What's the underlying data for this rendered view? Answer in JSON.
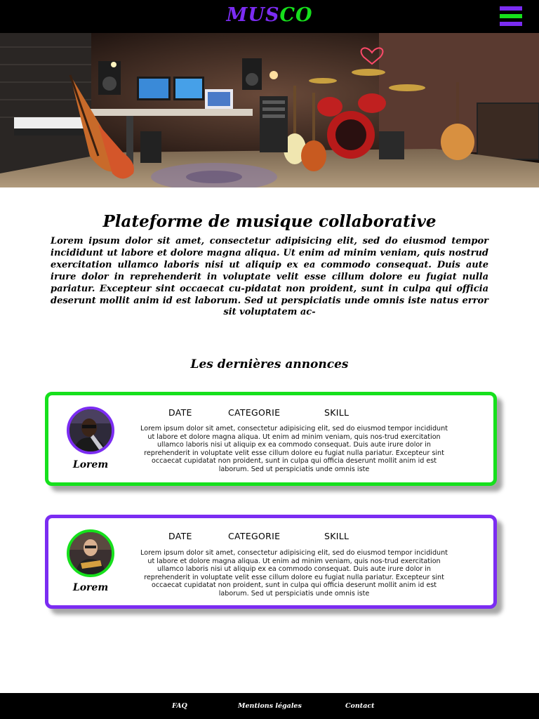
{
  "header": {
    "logo_part1": "MUS",
    "logo_part2": "CO",
    "menu_icon": "hamburger-menu-icon"
  },
  "colors": {
    "accent_purple": "#7b2cf2",
    "accent_green": "#16e01c",
    "header_bg": "#000000",
    "footer_bg": "#000000"
  },
  "hero": {
    "image": "music-studio-photo"
  },
  "intro": {
    "title": "Plateforme de musique collaborative",
    "text": "Lorem ipsum dolor sit amet, consectetur adipisicing elit, sed do eiusmod tempor incididunt ut labore et dolore magna aliqua. Ut enim ad minim veniam, quis nostrud exercitation ullamco laboris nisi ut aliquip ex ea commodo consequat. Duis aute irure dolor in reprehenderit in voluptate velit esse cillum dolore eu fugiat nulla pariatur. Excepteur sint occaecat cu-pidatat non proident, sunt in culpa qui officia deserunt mollit anim id est laborum. Sed ut perspiciatis unde omnis iste natus error sit voluptatem ac-"
  },
  "announcements": {
    "title": "Les dernières annonces",
    "cards": [
      {
        "name": "Lorem",
        "date": "DATE",
        "category": "CATEGORIE",
        "skill": "SKILL",
        "text": "Lorem ipsum dolor sit amet, consectetur adipisicing elit, sed do eiusmod tempor incididunt ut labore et dolore magna aliqua. Ut enim ad minim veniam, quis nos-trud exercitation ullamco laboris nisi ut aliquip ex ea commodo consequat. Duis aute irure dolor in reprehenderit in voluptate velit esse cillum dolore eu fugiat nulla pariatur. Excepteur sint occaecat cupidatat non proident, sunt in culpa qui officia deserunt mollit anim id est laborum. Sed ut perspiciatis unde omnis iste",
        "border_color": "#16e01c"
      },
      {
        "name": "Lorem",
        "date": "DATE",
        "category": "CATEGORIE",
        "skill": "SKILL",
        "text": "Lorem ipsum dolor sit amet, consectetur adipisicing elit, sed do eiusmod tempor incididunt ut labore et dolore magna aliqua. Ut enim ad minim veniam, quis nos-trud exercitation ullamco laboris nisi ut aliquip ex ea commodo consequat. Duis aute irure dolor in reprehenderit in voluptate velit esse cillum dolore eu fugiat nulla pariatur. Excepteur sint occaecat cupidatat non proident, sunt in culpa qui officia deserunt mollit anim id est laborum. Sed ut perspiciatis unde omnis iste",
        "border_color": "#7b2cf2"
      }
    ]
  },
  "footer": {
    "links": [
      "FAQ",
      "Mentions légales",
      "Contact"
    ]
  }
}
